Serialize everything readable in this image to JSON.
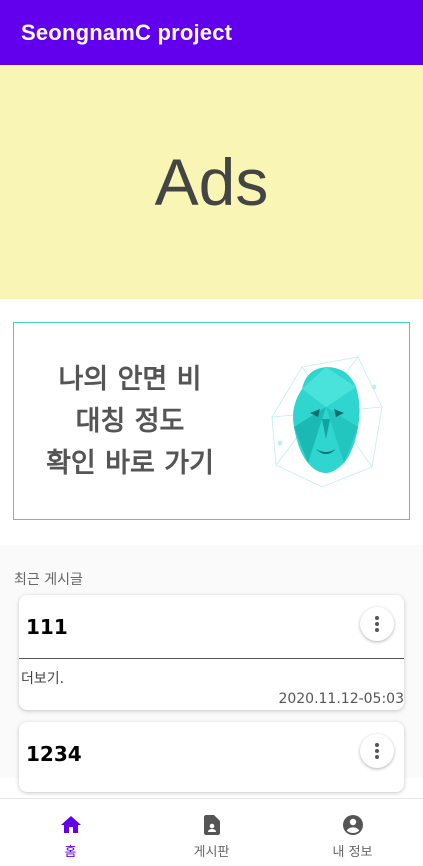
{
  "app_bar": {
    "title": "SeongnamC project"
  },
  "ad": {
    "text": "Ads"
  },
  "promo": {
    "lines": [
      "나의 안면 비",
      "대칭 정도",
      "확인 바로 가기"
    ],
    "face_icon": "face-mesh-icon"
  },
  "recent": {
    "label": "최근 게시글",
    "posts": [
      {
        "title": "111",
        "body": "더보기.",
        "date": "2020.11.12-05:03"
      },
      {
        "title": "1234"
      }
    ]
  },
  "nav": {
    "items": [
      {
        "label": "홈",
        "icon": "home-icon",
        "active": true
      },
      {
        "label": "게시판",
        "icon": "board-icon",
        "active": false
      },
      {
        "label": "내 정보",
        "icon": "account-icon",
        "active": false
      }
    ]
  },
  "colors": {
    "primary": "#6200ee",
    "ad_bg": "#f9f5b5",
    "accent": "#3fd0c8"
  }
}
